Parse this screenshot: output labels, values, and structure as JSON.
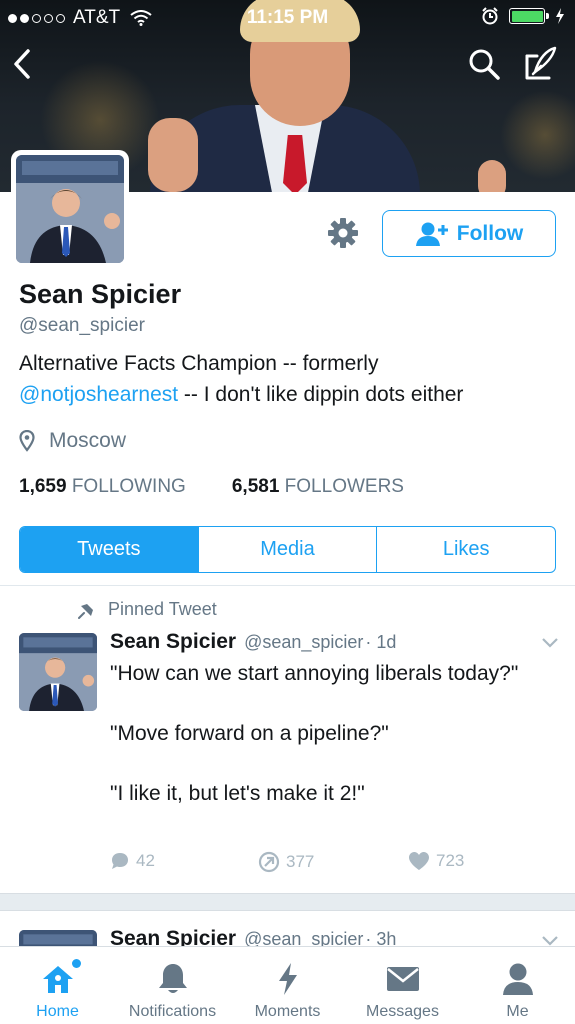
{
  "status_bar": {
    "carrier": "AT&T",
    "time": "11:15 PM"
  },
  "profile": {
    "name": "Sean Spicier",
    "handle": "@sean_spicier",
    "bio_part1": "Alternative Facts Champion -- formerly",
    "bio_link": "@notjoshearnest",
    "bio_part2": " -- I don't like dippin dots either",
    "location": "Moscow",
    "following_count": "1,659",
    "following_label": "FOLLOWING",
    "followers_count": "6,581",
    "followers_label": "FOLLOWERS",
    "follow_button": "Follow"
  },
  "tabs": [
    {
      "label": "Tweets",
      "active": true
    },
    {
      "label": "Media",
      "active": false
    },
    {
      "label": "Likes",
      "active": false
    }
  ],
  "pinned_tweet": {
    "pinned_label": "Pinned Tweet",
    "author": "Sean Spicier",
    "handle": "@sean_spicier",
    "time": "· 1d",
    "paragraphs": [
      "\"How can we start annoying liberals today?\"",
      "\"Move forward on a pipeline?\"",
      "\"I like it, but let's make it 2!\""
    ],
    "replies": "42",
    "retweets": "377",
    "likes": "723"
  },
  "next_tweet": {
    "author": "Sean Spicier",
    "handle": "@sean_spicier",
    "time": "· 3h"
  },
  "tab_bar": [
    {
      "label": "Home",
      "icon": "home-icon",
      "active": true
    },
    {
      "label": "Notifications",
      "icon": "bell-icon",
      "active": false
    },
    {
      "label": "Moments",
      "icon": "lightning-icon",
      "active": false
    },
    {
      "label": "Messages",
      "icon": "envelope-icon",
      "active": false
    },
    {
      "label": "Me",
      "icon": "person-icon",
      "active": false
    }
  ],
  "colors": {
    "accent": "#1da1f2",
    "text": "#14171a",
    "muted": "#657786",
    "action_gray": "#aab8c2"
  }
}
